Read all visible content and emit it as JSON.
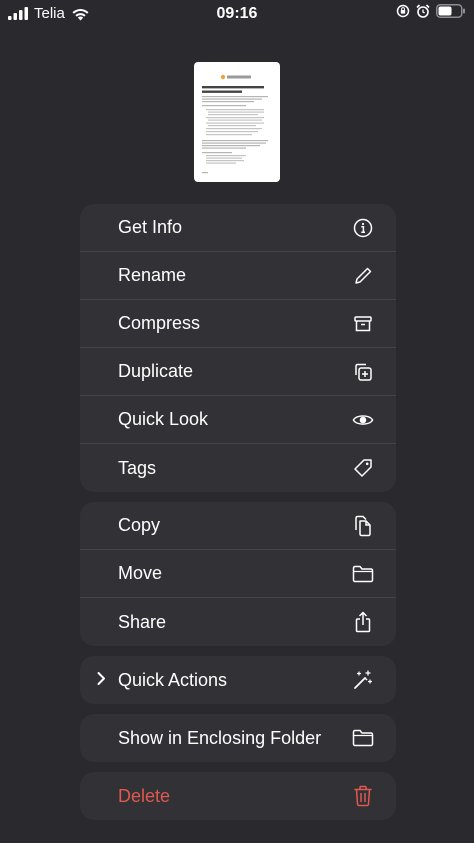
{
  "status_bar": {
    "carrier": "Telia",
    "time": "09:16"
  },
  "preview": {
    "icon": "document-thumbnail"
  },
  "menu": {
    "groups": [
      {
        "items": [
          {
            "label": "Get Info",
            "icon": "info-icon"
          },
          {
            "label": "Rename",
            "icon": "pencil-icon"
          },
          {
            "label": "Compress",
            "icon": "archive-box-icon"
          },
          {
            "label": "Duplicate",
            "icon": "duplicate-icon"
          },
          {
            "label": "Quick Look",
            "icon": "eye-icon"
          },
          {
            "label": "Tags",
            "icon": "tag-icon"
          }
        ]
      },
      {
        "items": [
          {
            "label": "Copy",
            "icon": "copy-icon"
          },
          {
            "label": "Move",
            "icon": "folder-icon"
          },
          {
            "label": "Share",
            "icon": "share-icon"
          }
        ]
      },
      {
        "items": [
          {
            "label": "Quick Actions",
            "icon": "sparkles-icon"
          }
        ]
      },
      {
        "items": [
          {
            "label": "Show in Enclosing Folder",
            "icon": "folder-icon"
          }
        ]
      },
      {
        "items": [
          {
            "label": "Delete",
            "icon": "trash-icon",
            "color": "#e0594e"
          }
        ]
      }
    ]
  }
}
